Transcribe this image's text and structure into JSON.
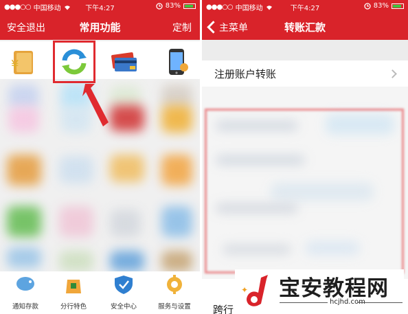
{
  "left_screen": {
    "status": {
      "carrier": "中国移动",
      "time": "下午4:27",
      "battery": "83%",
      "battery_level": 0.83
    },
    "nav": {
      "left": "安全退出",
      "title": "常用功能",
      "right": "定制"
    },
    "bottom_items": [
      {
        "label": "通知存款",
        "icon": "piggy-bank-icon"
      },
      {
        "label": "分行特色",
        "icon": "bag-icon"
      },
      {
        "label": "安全中心",
        "icon": "shield-icon"
      },
      {
        "label": "服务与设置",
        "icon": "gear-icon"
      }
    ]
  },
  "right_screen": {
    "status": {
      "carrier": "中国移动",
      "time": "下午4:27",
      "battery": "83%",
      "battery_level": 0.83
    },
    "nav": {
      "back": "主菜单",
      "title": "转账汇款"
    },
    "rows": {
      "first": "注册账户转账",
      "last": "跨行"
    }
  },
  "watermark": {
    "title": "宝安教程网",
    "url": "hcjhd.com"
  },
  "colors": {
    "brand_red": "#d9232a",
    "highlight": "#e02a2f"
  }
}
